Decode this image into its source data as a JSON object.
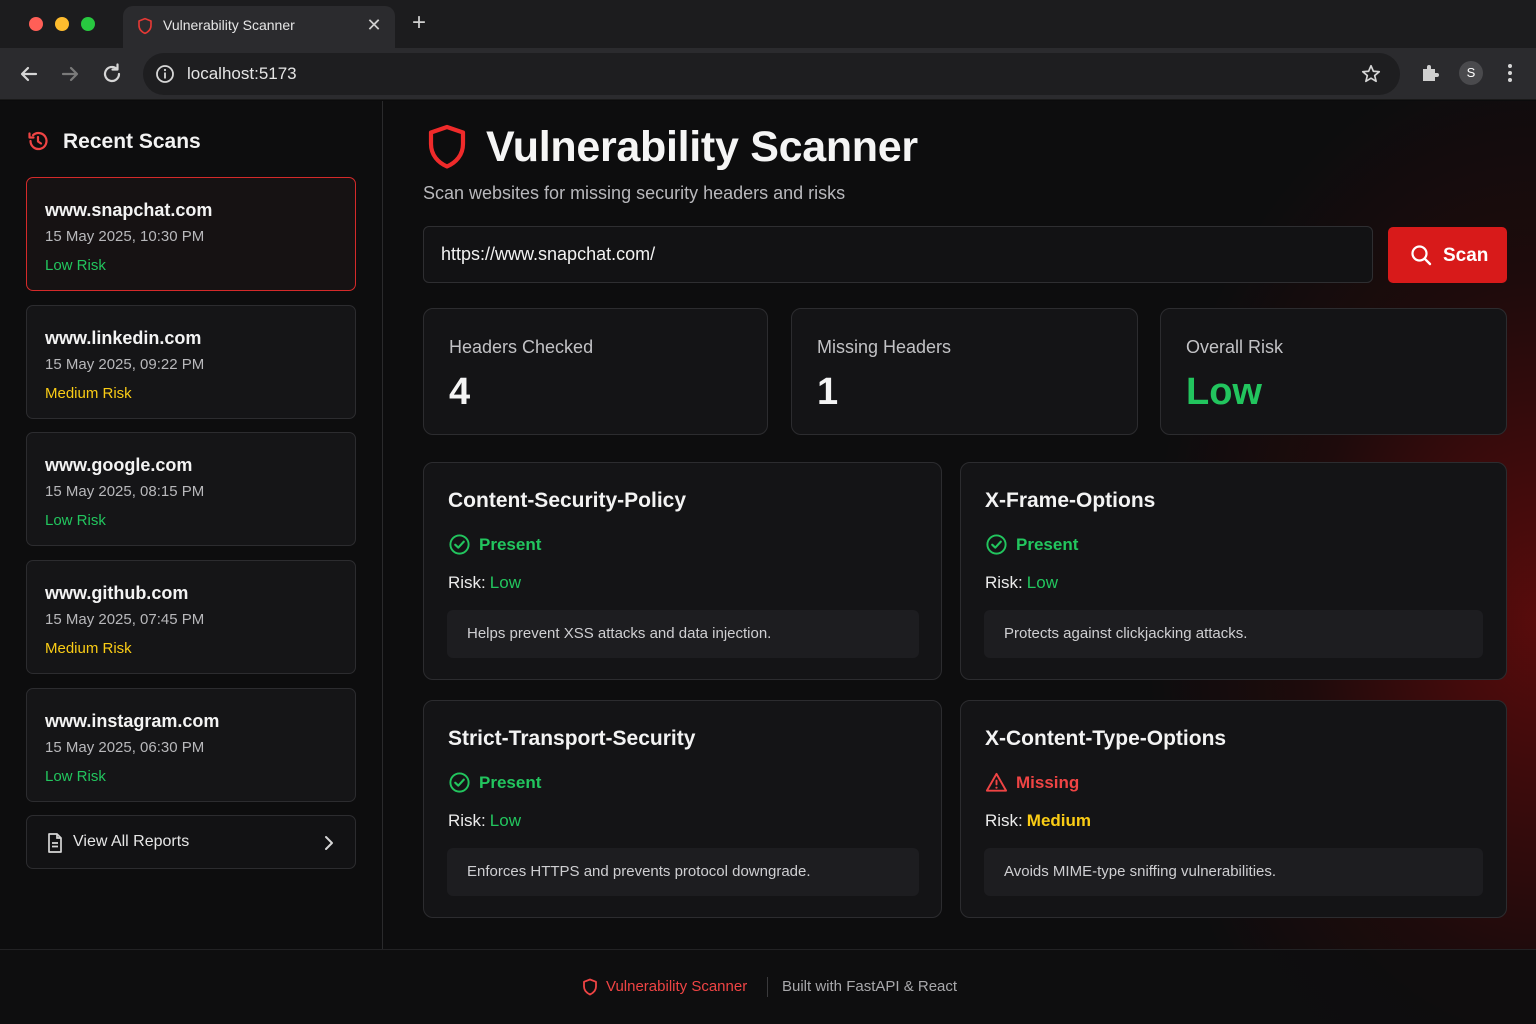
{
  "browser": {
    "tab_title": "Vulnerability Scanner",
    "url": "localhost:5173",
    "profile_initial": "S"
  },
  "sidebar": {
    "title": "Recent Scans",
    "scans": [
      {
        "domain": "www.snapchat.com",
        "date": "15 May 2025, 10:30 PM",
        "risk": "Low Risk",
        "risk_level": "low",
        "active": true
      },
      {
        "domain": "www.linkedin.com",
        "date": "15 May 2025, 09:22 PM",
        "risk": "Medium Risk",
        "risk_level": "medium",
        "active": false
      },
      {
        "domain": "www.google.com",
        "date": "15 May 2025, 08:15 PM",
        "risk": "Low Risk",
        "risk_level": "low",
        "active": false
      },
      {
        "domain": "www.github.com",
        "date": "15 May 2025, 07:45 PM",
        "risk": "Medium Risk",
        "risk_level": "medium",
        "active": false
      },
      {
        "domain": "www.instagram.com",
        "date": "15 May 2025, 06:30 PM",
        "risk": "Low Risk",
        "risk_level": "low",
        "active": false
      }
    ],
    "view_all_label": "View All Reports"
  },
  "main": {
    "title": "Vulnerability Scanner",
    "subtitle": "Scan websites for missing security headers and risks",
    "url_input_value": "https://www.snapchat.com/",
    "scan_button_label": "Scan",
    "stats": {
      "headers_checked_label": "Headers Checked",
      "headers_checked_value": "4",
      "missing_headers_label": "Missing Headers",
      "missing_headers_value": "1",
      "overall_risk_label": "Overall Risk",
      "overall_risk_value": "Low"
    },
    "risk_prefix": "Risk:",
    "headers": [
      {
        "name": "Content-Security-Policy",
        "status": "Present",
        "risk": "Low",
        "description": "Helps prevent XSS attacks and data injection."
      },
      {
        "name": "X-Frame-Options",
        "status": "Present",
        "risk": "Low",
        "description": "Protects against clickjacking attacks."
      },
      {
        "name": "Strict-Transport-Security",
        "status": "Present",
        "risk": "Low",
        "description": "Enforces HTTPS and prevents protocol downgrade."
      },
      {
        "name": "X-Content-Type-Options",
        "status": "Missing",
        "risk": "Medium",
        "description": "Avoids MIME-type sniffing vulnerabilities."
      }
    ]
  },
  "footer": {
    "brand": "Vulnerability Scanner",
    "built_with": "Built with FastAPI & React"
  },
  "colors": {
    "accent_red": "#d81a1a",
    "low_green": "#22c55e",
    "medium_yellow": "#facc15",
    "missing_red": "#ef4444"
  }
}
